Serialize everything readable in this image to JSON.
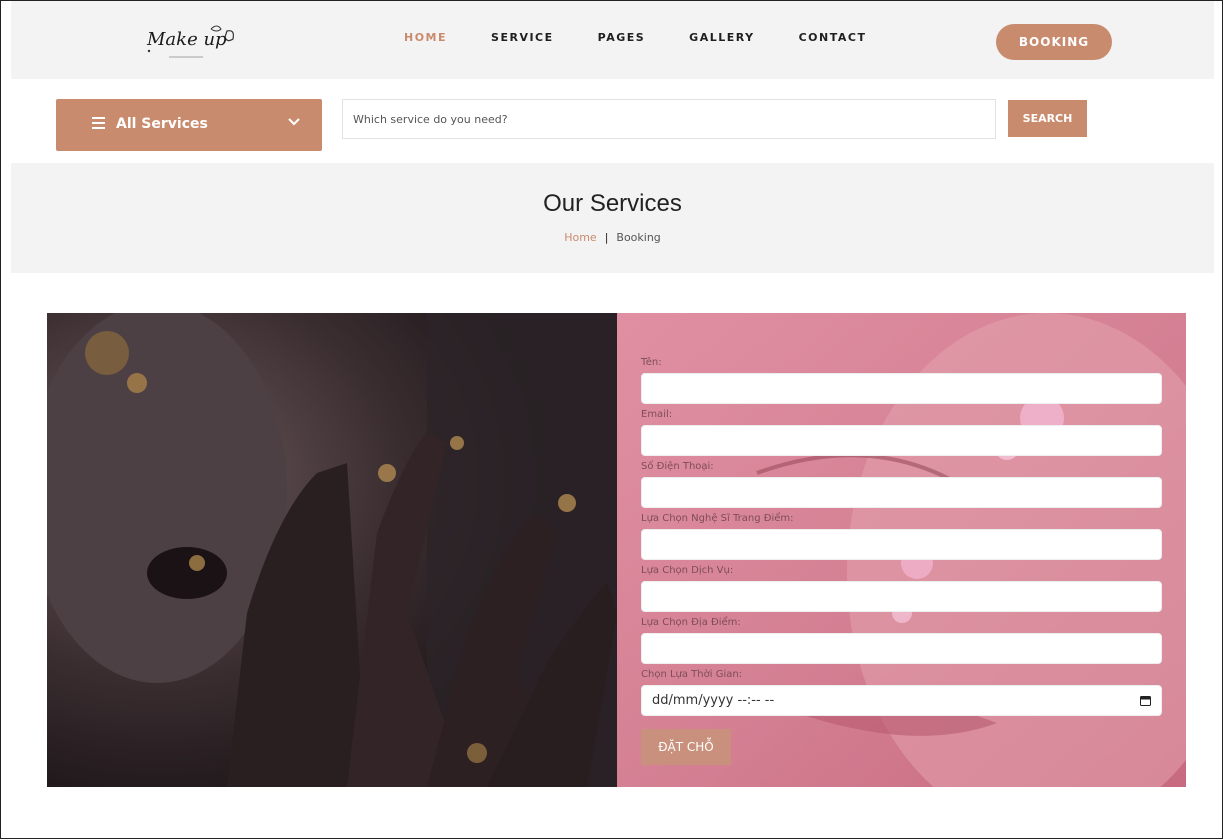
{
  "header": {
    "logo_text": "Make up",
    "nav": [
      "HOME",
      "SERVICE",
      "PAGES",
      "GALLERY",
      "CONTACT"
    ],
    "active_nav": "HOME",
    "booking_label": "BOOKING"
  },
  "search": {
    "services_label": "All Services",
    "placeholder": "Which service do you need?",
    "button_label": "SEARCH"
  },
  "banner": {
    "title": "Our Services",
    "crumb_home": "Home",
    "crumb_sep": "|",
    "crumb_current": "Booking"
  },
  "form": {
    "labels": [
      "Tên:",
      "Email:",
      "Số Điện Thoại:",
      "Lựa Chọn Nghệ Sĩ Trang Điểm:",
      "Lựa Chọn Dịch Vụ:",
      "Lựa Chọn Địa Điểm:",
      "Chọn Lựa Thời Gian:"
    ],
    "date_placeholder": "dd/mm/yyyy --:-- --",
    "submit_label": "ĐẶT CHỖ"
  },
  "colors": {
    "accent": "#c98b6e",
    "panel_pink": "#d98a9c"
  },
  "icons": [
    "menu-icon",
    "chevron-down-icon",
    "calendar-icon"
  ]
}
